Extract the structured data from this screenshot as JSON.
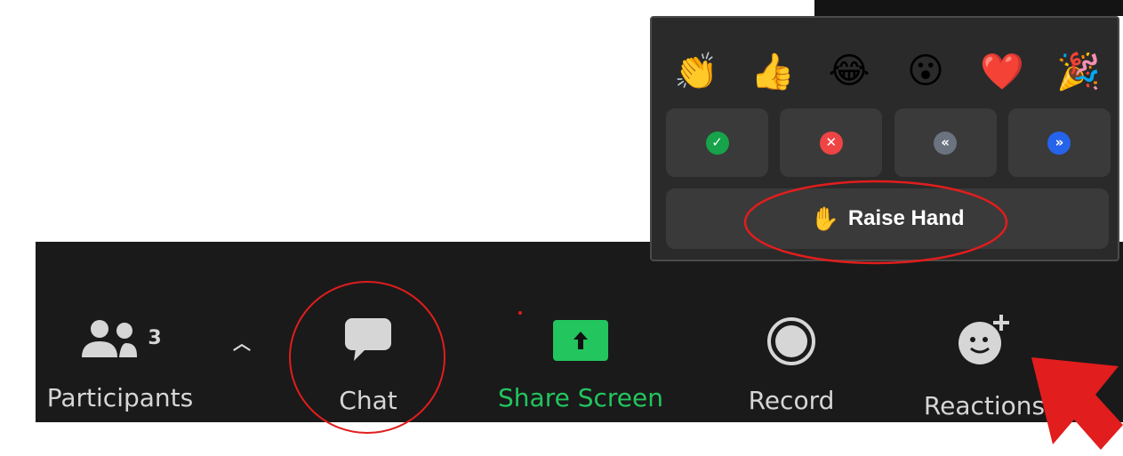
{
  "toolbar": {
    "participants": {
      "label": "Participants",
      "count": "3"
    },
    "chat": {
      "label": "Chat"
    },
    "share_screen": {
      "label": "Share Screen"
    },
    "record": {
      "label": "Record"
    },
    "reactions": {
      "label": "Reactions"
    }
  },
  "reactions_popup": {
    "emojis": [
      "👏",
      "👍",
      "😂",
      "😮",
      "❤️",
      "🎉"
    ],
    "feedback_buttons": [
      {
        "name": "yes",
        "glyph": "✓",
        "color": "#16a34a"
      },
      {
        "name": "no",
        "glyph": "✕",
        "color": "#ef4444"
      },
      {
        "name": "slow-down",
        "glyph": "«",
        "color": "#6b7280"
      },
      {
        "name": "speed-up",
        "glyph": "»",
        "color": "#2563eb"
      }
    ],
    "raise_hand": {
      "icon": "✋",
      "label": "Raise Hand"
    }
  },
  "colors": {
    "toolbar_bg": "#1a1a1a",
    "popup_bg": "#2a2a2a",
    "button_bg": "#3a3a3a",
    "share_green": "#22c55e",
    "annotation_red": "#e11d1d",
    "text": "#d6d6d6"
  }
}
